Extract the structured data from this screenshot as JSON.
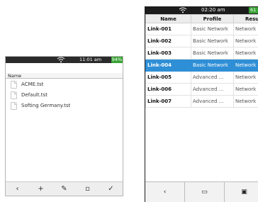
{
  "left": {
    "status": {
      "time": "11:01 am",
      "battery": "94%"
    },
    "column_header": "Name",
    "files": [
      "ACME.tst",
      "Default.tst",
      "Softing Germany.tst"
    ],
    "toolbar": [
      {
        "icon": "back-icon",
        "glyph": "‹"
      },
      {
        "icon": "add-icon",
        "glyph": "+"
      },
      {
        "icon": "pencil-icon",
        "glyph": "✎"
      },
      {
        "icon": "trash-icon",
        "glyph": "▫"
      },
      {
        "icon": "check-icon",
        "glyph": "✓"
      }
    ]
  },
  "right": {
    "status": {
      "time": "02:20 am",
      "battery": "61"
    },
    "columns": [
      "Name",
      "Profile",
      "Result"
    ],
    "rows": [
      {
        "name": "Link-001",
        "profile": "Basic Network",
        "result": "Network"
      },
      {
        "name": "Link-002",
        "profile": "Basic Network",
        "result": "Network"
      },
      {
        "name": "Link-003",
        "profile": "Basic Network",
        "result": "Network"
      },
      {
        "name": "Link-004",
        "profile": "Basic Network",
        "result": "Network",
        "selected": true
      },
      {
        "name": "Link-005",
        "profile": "Advanced ...",
        "result": "Network"
      },
      {
        "name": "Link-006",
        "profile": "Advanced ...",
        "result": "Network"
      },
      {
        "name": "Link-007",
        "profile": "Advanced ...",
        "result": "Network"
      }
    ],
    "toolbar": [
      {
        "icon": "back-icon",
        "glyph": "‹"
      },
      {
        "icon": "folder-icon",
        "glyph": "▭"
      },
      {
        "icon": "save-icon",
        "glyph": "▣"
      }
    ]
  }
}
